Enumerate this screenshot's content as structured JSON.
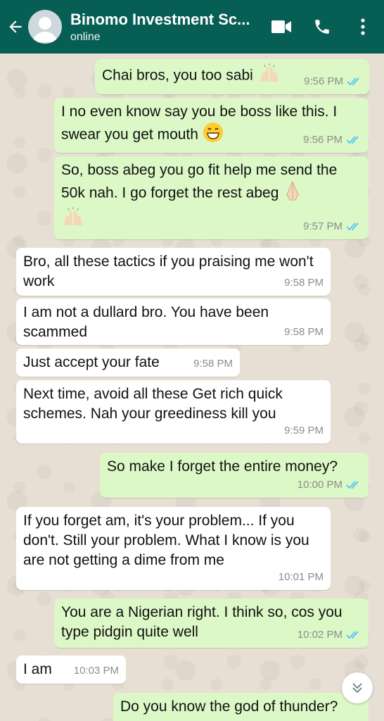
{
  "header": {
    "title": "Binomo Investment Sc...",
    "status": "online"
  },
  "icons": {
    "back": "arrow-left-icon",
    "video": "videocam-icon",
    "call": "phone-icon",
    "menu": "more-vert-icon",
    "scroll": "double-chevron-down-icon"
  },
  "colors": {
    "header": "#075e54",
    "outgoing": "#dcf8c6",
    "incoming": "#ffffff",
    "read_ticks": "#4fc3f7",
    "background": "#e7dfd4"
  },
  "messages": [
    {
      "dir": "out",
      "text": "Chai bros, you too sabi",
      "time": "9:56 PM",
      "read": true,
      "emoji": [
        "raising-hands"
      ]
    },
    {
      "dir": "out",
      "text": "I no even know say you be boss like this. I swear you get mouth",
      "time": "9:56 PM",
      "read": true,
      "emoji": [
        "grinning-face"
      ]
    },
    {
      "dir": "out",
      "text": "So, boss abeg you go fit help me send the 50k nah. I go forget the rest abeg",
      "time": "9:57 PM",
      "read": true,
      "emoji": [
        "folded-hands",
        "raising-hands"
      ]
    },
    {
      "dir": "in",
      "text": "Bro, all these tactics if you praising me won't work",
      "time": "9:58 PM"
    },
    {
      "dir": "in",
      "text": "I am not a dullard bro. You have been scammed",
      "time": "9:58 PM"
    },
    {
      "dir": "in",
      "text": "Just accept your fate",
      "time": "9:58 PM"
    },
    {
      "dir": "in",
      "text": "Next time, avoid all these Get rich quick schemes. Nah your greediness kill you",
      "time": "9:59 PM"
    },
    {
      "dir": "out",
      "text": "So make I forget the entire money?",
      "time": "10:00 PM",
      "read": true
    },
    {
      "dir": "in",
      "text": "If you forget am, it's your problem... If you don't. Still your problem. What I know is you are not getting a dime from me",
      "time": "10:01 PM"
    },
    {
      "dir": "out",
      "text": "You are a Nigerian right. I think so, cos you type pidgin quite well",
      "time": "10:02 PM",
      "read": true
    },
    {
      "dir": "in",
      "text": "I am",
      "time": "10:03 PM"
    },
    {
      "dir": "out",
      "text": "Do you know the god of thunder?",
      "time": "",
      "read": true
    }
  ]
}
